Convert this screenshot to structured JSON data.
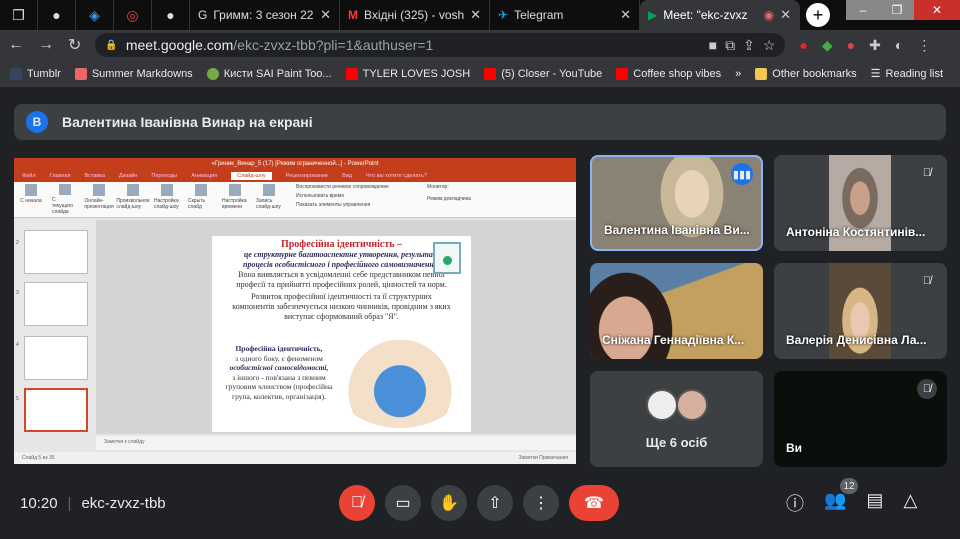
{
  "browser": {
    "pinned_tabs": [
      {
        "icon": "app-icon",
        "glyph": "❒"
      },
      {
        "icon": "globe-icon",
        "glyph": "●"
      },
      {
        "icon": "dots-icon",
        "glyph": "◈"
      },
      {
        "icon": "circle-logo-icon",
        "glyph": "◎"
      },
      {
        "icon": "globe-icon",
        "glyph": "●"
      }
    ],
    "tabs": [
      {
        "title": "Гримм: 3 сезон 22 с",
        "icon": "G"
      },
      {
        "title": "Вхідні (325) - voshyl",
        "icon": "M"
      },
      {
        "title": "Telegram",
        "icon": "✈"
      },
      {
        "title": "Meet: \"ekc-zvxz",
        "icon": "▶",
        "active": true
      }
    ],
    "url_host": "meet.google.com",
    "url_path": "/ekc-zvxz-tbb?pli=1&authuser=1",
    "bookmarks": [
      {
        "label": "Tumblr",
        "color": "#35465c"
      },
      {
        "label": "Summer Markdowns",
        "color": "#e66"
      },
      {
        "label": "Кисти SAI Paint Too...",
        "color": "#7a4"
      },
      {
        "label": "TYLER LOVES JOSH",
        "color": "#f00"
      },
      {
        "label": "(5) Closer - YouTube",
        "color": "#f00"
      },
      {
        "label": "Coffee shop vibes",
        "color": "#f00"
      }
    ],
    "more_bookmarks": "»",
    "other_bookmarks": "Other bookmarks",
    "reading_list": "Reading list"
  },
  "presenter_banner": {
    "avatar": "В",
    "text": "Валентина Іванівна Винар на екрані"
  },
  "powerpoint": {
    "title": "«Гриник_Винар_5 (17) [Режим ограниченной...] - PowerPoint",
    "tabs": [
      "Файл",
      "Главная",
      "Вставка",
      "Дизайн",
      "Переходы",
      "Анимация",
      "Слайд-шоу",
      "Рецензирование",
      "Вид",
      "Что вы хотите сделать?"
    ],
    "active_tab": "Слайд-шоу",
    "ribbon": [
      "С начала",
      "С текущего слайда",
      "Онлайн-презентация",
      "Произвольное слайд-шоу",
      "Настройка слайд-шоу",
      "Скрыть слайд",
      "Настройка времени",
      "Запись слайд-шоу"
    ],
    "options": [
      "Воспроизвести речевое сопровождение",
      "Использовать время",
      "Показать элементы управления"
    ],
    "monitor": "Монитор:",
    "presenter_view": "Режим докладчика",
    "slide": {
      "heading": "Професійна ідентичність –",
      "def": "це структурне багатоаспектне утворення, результат процесів особистісного і професійного самовизначення.",
      "p1": "Вона виявляється в усвідомленні себе представником певної професії та прийнятті професійних ролей, цінностей та норм.",
      "p2": "Розвиток професійної ідентичності та її структурних компонентів забезпечується низкою чинників, провідним з яких виступає сформований образ \"Я\".",
      "left_title": "Професійна ідентичність,",
      "left_1": "з одного боку, є феноменом",
      "left_2": "особистісної самосвідомості,",
      "left_3": "з іншого - пов'язана з певним груповим членством (професійна група, колектив, організація)."
    },
    "thumb_numbers": [
      "2",
      "3",
      "4",
      "5"
    ],
    "notes": "Заметки к слайду",
    "status_left": "Слайд 5 из 35",
    "status_right": "Заметки   Примечания"
  },
  "participants": [
    {
      "name": "Валентина Іванівна Ви...",
      "speaking": true
    },
    {
      "name": "Антоніна Костянтинів...",
      "muted": true
    },
    {
      "name": "Сніжана Геннадіївна К..."
    },
    {
      "name": "Валерія Денисівна Ла...",
      "muted": true
    },
    {
      "name": "Ще 6 осіб"
    },
    {
      "name": "Ви",
      "muted": true
    }
  ],
  "bottom": {
    "time": "10:20",
    "meeting_code": "ekc-zvxz-tbb",
    "participant_count": "12"
  },
  "colors": {
    "accent": "#1a73e8",
    "danger": "#ea4335",
    "bg": "#202124",
    "surface": "#3c4043"
  }
}
